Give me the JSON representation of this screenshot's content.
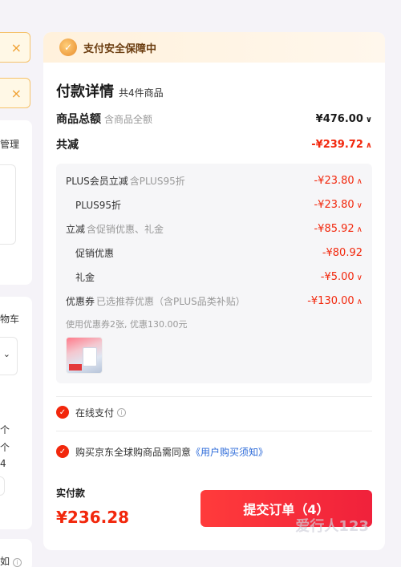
{
  "left": {
    "close_symbol": "×",
    "texts": [
      "管理",
      "物车",
      "个",
      "个",
      "4",
      "如"
    ]
  },
  "safety": {
    "label": "支付安全保障中"
  },
  "detail": {
    "title": "付款详情",
    "count": "共4件商品"
  },
  "total": {
    "label": "商品总额",
    "note": "含商品全额",
    "amount": "¥476.00"
  },
  "reduce": {
    "label": "共减",
    "amount": "-¥239.72"
  },
  "breakdown": {
    "plus": {
      "label": "PLUS会员立减",
      "note": "含PLUS95折",
      "amount": "-¥23.80"
    },
    "plus95": {
      "label": "PLUS95折",
      "amount": "-¥23.80"
    },
    "lijian": {
      "label": "立减",
      "note": "含促销优惠、礼金",
      "amount": "-¥85.92"
    },
    "promo": {
      "label": "促销优惠",
      "amount": "-¥80.92"
    },
    "gift": {
      "label": "礼金",
      "amount": "-¥5.00"
    },
    "coupon": {
      "label": "优惠券",
      "note": "已选推荐优惠（含PLUS品类补贴）",
      "amount": "-¥130.00"
    },
    "coupon_note": "使用优惠券2张, 优惠130.00元"
  },
  "online_pay": {
    "label": "在线支付"
  },
  "agreement": {
    "text": "购买京东全球购商品需同意",
    "link": "《用户购买须知》"
  },
  "pay": {
    "label": "实付款",
    "amount": "¥236.28"
  },
  "submit": {
    "label": "提交订单（4）"
  },
  "watermark": "爱行人123",
  "colors": {
    "accent": "#f2270c",
    "link": "#2d6bd9",
    "safety_bg": "#fff1dc"
  }
}
